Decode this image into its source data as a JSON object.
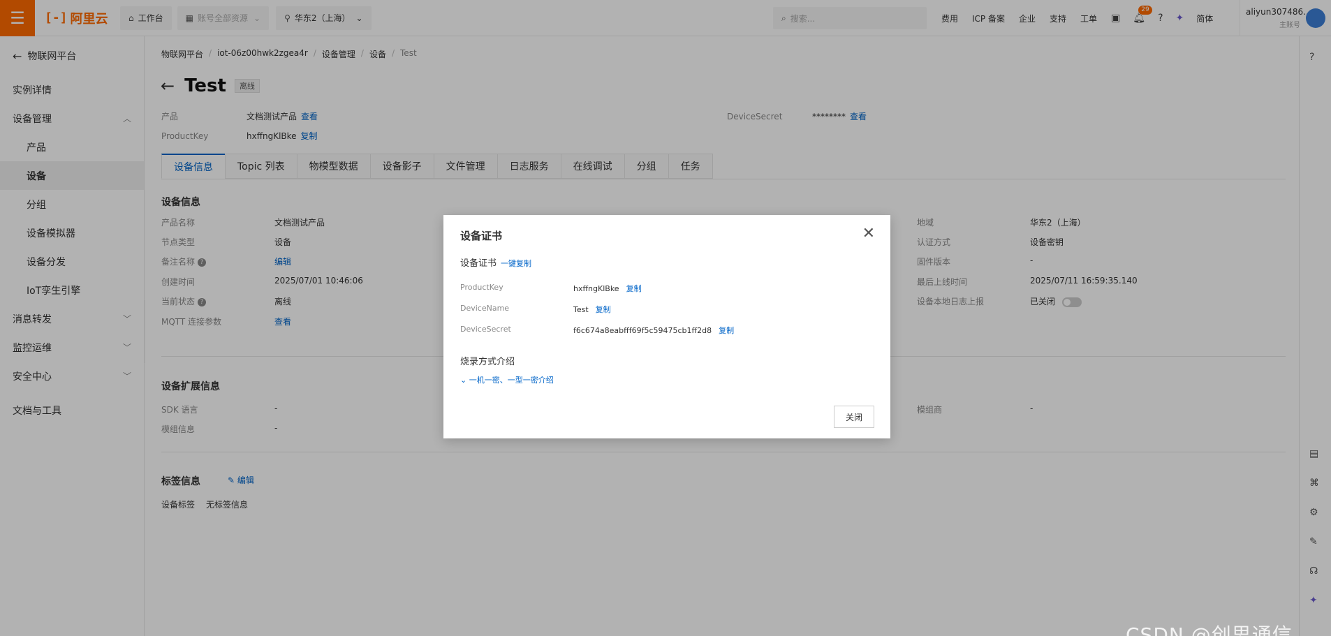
{
  "topbar": {
    "logo_text": "阿里云",
    "workbench": "工作台",
    "resources": "账号全部资源",
    "region": "华东2（上海）",
    "search_placeholder": "搜索...",
    "links": [
      "费用",
      "ICP 备案",
      "企业",
      "支持",
      "工单"
    ],
    "notification_count": "29",
    "lang": "简体",
    "account_name": "aliyun307486...",
    "account_role": "主账号"
  },
  "sidebar": {
    "back_label": "物联网平台",
    "items": [
      {
        "label": "实例详情",
        "sub": false
      },
      {
        "label": "设备管理",
        "sub": false,
        "expanded": true
      },
      {
        "label": "产品",
        "sub": true
      },
      {
        "label": "设备",
        "sub": true,
        "active": true
      },
      {
        "label": "分组",
        "sub": true
      },
      {
        "label": "设备模拟器",
        "sub": true
      },
      {
        "label": "设备分发",
        "sub": true
      },
      {
        "label": "IoT孪生引擎",
        "sub": true
      },
      {
        "label": "消息转发",
        "sub": false
      },
      {
        "label": "监控运维",
        "sub": false
      },
      {
        "label": "安全中心",
        "sub": false
      },
      {
        "label": "文档与工具",
        "sub": false
      }
    ]
  },
  "breadcrumb": [
    "物联网平台",
    "iot-06z00hwk2zgea4r",
    "设备管理",
    "设备",
    "Test"
  ],
  "device": {
    "name": "Test",
    "status": "离线",
    "product_label": "产品",
    "product_value": "文档测试产品",
    "view_link": "查看",
    "productkey_label": "ProductKey",
    "productkey_value": "hxffngKlBke",
    "copy_link": "复制",
    "secret_label": "DeviceSecret",
    "secret_value": "********"
  },
  "tabs": [
    "设备信息",
    "Topic 列表",
    "物模型数据",
    "设备影子",
    "文件管理",
    "日志服务",
    "在线调试",
    "分组",
    "任务"
  ],
  "info": {
    "section_title": "设备信息",
    "left": [
      {
        "k": "产品名称",
        "v": "文档测试产品"
      },
      {
        "k": "节点类型",
        "v": "设备"
      },
      {
        "k": "备注名称",
        "v": "编辑",
        "link": true,
        "help": true
      },
      {
        "k": "创建时间",
        "v": "2025/07/01 10:46:06"
      },
      {
        "k": "当前状态",
        "v": "离线",
        "help": true
      },
      {
        "k": "MQTT 连接参数",
        "v": "查看",
        "link": true
      }
    ],
    "right": [
      {
        "k": "地域",
        "v": "华东2（上海）"
      },
      {
        "k": "认证方式",
        "v": "设备密钥"
      },
      {
        "k": "固件版本",
        "v": "-"
      },
      {
        "k": "最后上线时间",
        "v": "2025/07/11 16:59:35.140"
      },
      {
        "k": "设备本地日志上报",
        "v": "已关闭"
      }
    ]
  },
  "ext": {
    "section_title": "设备扩展信息",
    "rows": [
      {
        "k": "SDK 语言",
        "v": "-"
      },
      {
        "k": "模组信息",
        "v": "-"
      }
    ],
    "right_k": "模组商",
    "right_v": "-"
  },
  "tags": {
    "section_title": "标签信息",
    "edit_link": "编辑",
    "label": "设备标签",
    "value": "无标签信息"
  },
  "modal": {
    "title": "设备证书",
    "subtitle": "设备证书",
    "copy_all": "一键复制",
    "rows": [
      {
        "k": "ProductKey",
        "v": "hxffngKlBke"
      },
      {
        "k": "DeviceName",
        "v": "Test"
      },
      {
        "k": "DeviceSecret",
        "v": "f6c674a8eabfff69f5c59475cb1ff2d8"
      }
    ],
    "copy_label": "复制",
    "burn_title": "烧录方式介绍",
    "burn_link": "一机一密、一型一密介绍",
    "close_btn": "关闭"
  },
  "watermark": "CSDN @创思通信"
}
